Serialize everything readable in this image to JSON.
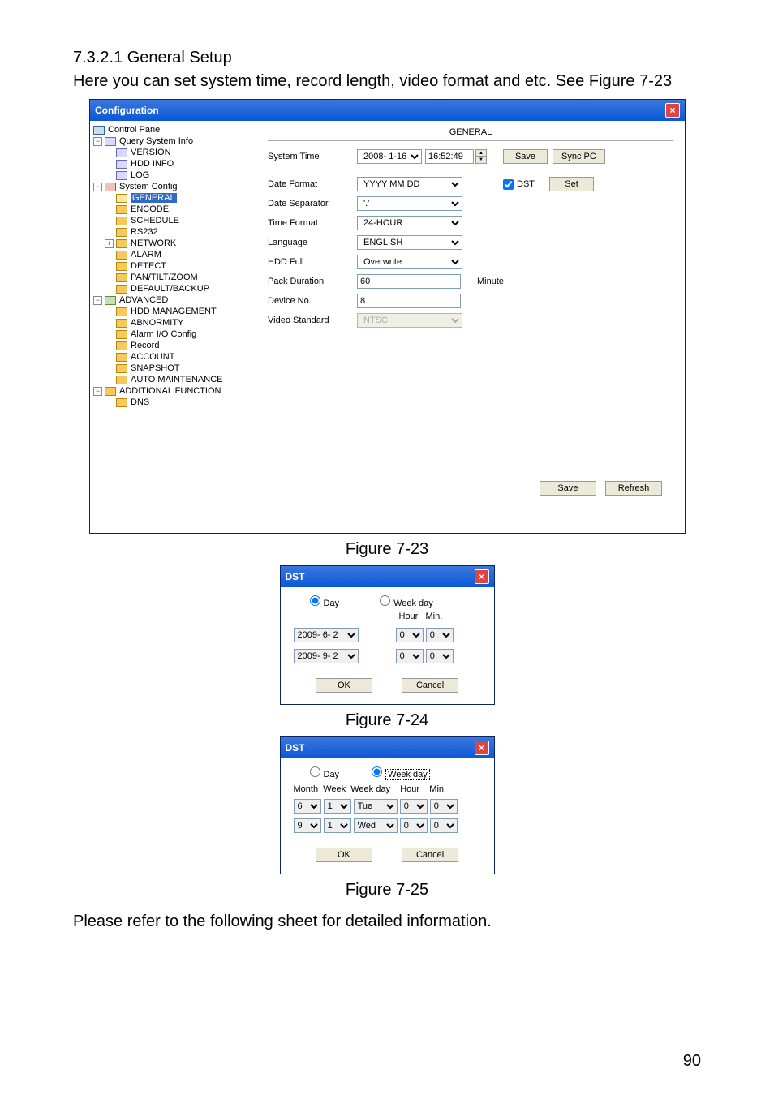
{
  "heading": "7.3.2.1  General Setup",
  "desc": "Here you can set system time, record length, video format and etc. See Figure 7-23",
  "main": {
    "title": "Configuration",
    "tree": {
      "root": "Control Panel",
      "qsi": "Query System Info",
      "version": "VERSION",
      "hddinfo": "HDD INFO",
      "log": "LOG",
      "sys": "System Config",
      "general": "GENERAL",
      "encode": "ENCODE",
      "schedule": "SCHEDULE",
      "rs232": "RS232",
      "network": "NETWORK",
      "alarm": "ALARM",
      "detect": "DETECT",
      "ptz": "PAN/TILT/ZOOM",
      "defbk": "DEFAULT/BACKUP",
      "adv": "ADVANCED",
      "hddmgmt": "HDD MANAGEMENT",
      "abn": "ABNORMITY",
      "alarmio": "Alarm I/O Config",
      "record": "Record",
      "account": "ACCOUNT",
      "snapshot": "SNAPSHOT",
      "automaint": "AUTO MAINTENANCE",
      "addfn": "ADDITIONAL FUNCTION",
      "dns": "DNS"
    },
    "panel": "GENERAL",
    "rows": {
      "systime": "System Time",
      "date_val": "2008- 1-16",
      "time_val": "16:52:49",
      "save": "Save",
      "syncpc": "Sync PC",
      "datefmt": "Date Format",
      "datefmt_val": "YYYY MM DD",
      "dst": "DST",
      "set": "Set",
      "datesep": "Date Separator",
      "datesep_val": "'.'",
      "timefmt": "Time Format",
      "timefmt_val": "24-HOUR",
      "lang": "Language",
      "lang_val": "ENGLISH",
      "hddfull": "HDD Full",
      "hddfull_val": "Overwrite",
      "packdur": "Pack Duration",
      "packdur_val": "60",
      "minute": "Minute",
      "devno": "Device No.",
      "devno_val": "8",
      "vidstd": "Video Standard",
      "vidstd_val": "NTSC"
    },
    "refresh": "Refresh"
  },
  "fig23": "Figure 7-23",
  "dst1": {
    "title": "DST",
    "day": "Day",
    "week": "Week day",
    "hour": "Hour",
    "min": "Min.",
    "d1": "2009- 6- 2",
    "d2": "2009- 9- 2",
    "h": "0",
    "m": "0",
    "ok": "OK",
    "cancel": "Cancel"
  },
  "fig24": "Figure 7-24",
  "dst2": {
    "title": "DST",
    "day": "Day",
    "week": "Week day",
    "month": "Month",
    "wk": "Week",
    "wkday": "Week day",
    "hour": "Hour",
    "min": "Min.",
    "r1": {
      "mon": "6",
      "wk": "1",
      "wd": "Tue",
      "h": "0",
      "m": "0"
    },
    "r2": {
      "mon": "9",
      "wk": "1",
      "wd": "Wed",
      "h": "0",
      "m": "0"
    },
    "ok": "OK",
    "cancel": "Cancel"
  },
  "fig25": "Figure 7-25",
  "footnote": "Please refer to the following sheet for detailed information.",
  "page": "90"
}
